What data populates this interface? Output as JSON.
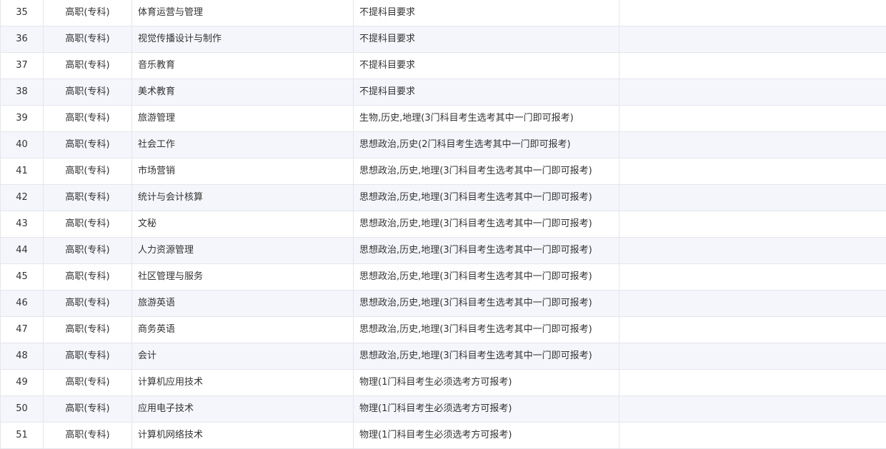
{
  "table": {
    "rows": [
      {
        "index": "35",
        "level": "高职(专科)",
        "major": "体育运营与管理",
        "requirement": "不提科目要求",
        "extra": ""
      },
      {
        "index": "36",
        "level": "高职(专科)",
        "major": "视觉传播设计与制作",
        "requirement": "不提科目要求",
        "extra": ""
      },
      {
        "index": "37",
        "level": "高职(专科)",
        "major": "音乐教育",
        "requirement": "不提科目要求",
        "extra": ""
      },
      {
        "index": "38",
        "level": "高职(专科)",
        "major": "美术教育",
        "requirement": "不提科目要求",
        "extra": ""
      },
      {
        "index": "39",
        "level": "高职(专科)",
        "major": "旅游管理",
        "requirement": "生物,历史,地理(3门科目考生选考其中一门即可报考)",
        "extra": ""
      },
      {
        "index": "40",
        "level": "高职(专科)",
        "major": "社会工作",
        "requirement": "思想政治,历史(2门科目考生选考其中一门即可报考)",
        "extra": ""
      },
      {
        "index": "41",
        "level": "高职(专科)",
        "major": "市场营销",
        "requirement": "思想政治,历史,地理(3门科目考生选考其中一门即可报考)",
        "extra": ""
      },
      {
        "index": "42",
        "level": "高职(专科)",
        "major": "统计与会计核算",
        "requirement": "思想政治,历史,地理(3门科目考生选考其中一门即可报考)",
        "extra": ""
      },
      {
        "index": "43",
        "level": "高职(专科)",
        "major": "文秘",
        "requirement": "思想政治,历史,地理(3门科目考生选考其中一门即可报考)",
        "extra": ""
      },
      {
        "index": "44",
        "level": "高职(专科)",
        "major": "人力资源管理",
        "requirement": "思想政治,历史,地理(3门科目考生选考其中一门即可报考)",
        "extra": ""
      },
      {
        "index": "45",
        "level": "高职(专科)",
        "major": "社区管理与服务",
        "requirement": "思想政治,历史,地理(3门科目考生选考其中一门即可报考)",
        "extra": ""
      },
      {
        "index": "46",
        "level": "高职(专科)",
        "major": "旅游英语",
        "requirement": "思想政治,历史,地理(3门科目考生选考其中一门即可报考)",
        "extra": ""
      },
      {
        "index": "47",
        "level": "高职(专科)",
        "major": "商务英语",
        "requirement": "思想政治,历史,地理(3门科目考生选考其中一门即可报考)",
        "extra": ""
      },
      {
        "index": "48",
        "level": "高职(专科)",
        "major": "会计",
        "requirement": "思想政治,历史,地理(3门科目考生选考其中一门即可报考)",
        "extra": ""
      },
      {
        "index": "49",
        "level": "高职(专科)",
        "major": "计算机应用技术",
        "requirement": "物理(1门科目考生必须选考方可报考)",
        "extra": ""
      },
      {
        "index": "50",
        "level": "高职(专科)",
        "major": "应用电子技术",
        "requirement": "物理(1门科目考生必须选考方可报考)",
        "extra": ""
      },
      {
        "index": "51",
        "level": "高职(专科)",
        "major": "计算机网络技术",
        "requirement": "物理(1门科目考生必须选考方可报考)",
        "extra": ""
      }
    ]
  }
}
